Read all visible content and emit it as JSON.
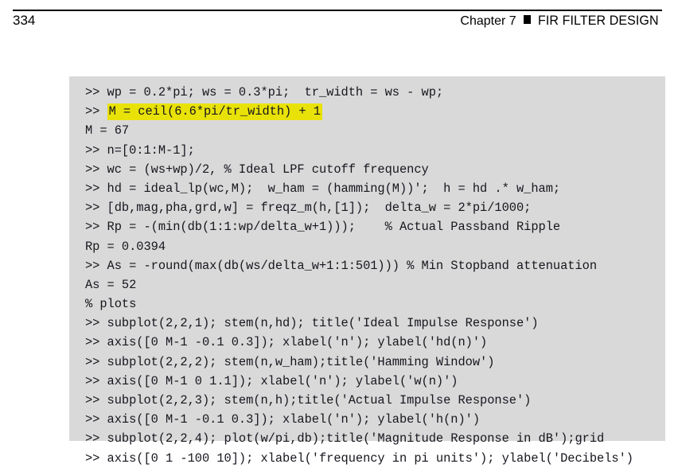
{
  "header": {
    "page_number": "334",
    "chapter_label": "Chapter 7",
    "bullet": "square-bullet",
    "chapter_title": "FIR FILTER DESIGN"
  },
  "code_block": {
    "background_color": "#d9d9d9",
    "text_color": "#16161e",
    "highlight_color": "#e9e209",
    "lines": [
      {
        "text": ">> wp = 0.2*pi; ws = 0.3*pi;  tr_width = ws - wp;",
        "highlight": null
      },
      {
        "text": ">> M = ceil(6.6*pi/tr_width) + 1",
        "highlight": "M = ceil(6.6*pi/tr_width) + 1"
      },
      {
        "text": "M = 67",
        "highlight": null
      },
      {
        "text": ">> n=[0:1:M-1];",
        "highlight": null
      },
      {
        "text": ">> wc = (ws+wp)/2, % Ideal LPF cutoff frequency",
        "highlight": null
      },
      {
        "text": ">> hd = ideal_lp(wc,M);  w_ham = (hamming(M))';  h = hd .* w_ham;",
        "highlight": null
      },
      {
        "text": ">> [db,mag,pha,grd,w] = freqz_m(h,[1]);  delta_w = 2*pi/1000;",
        "highlight": null
      },
      {
        "text": ">> Rp = -(min(db(1:1:wp/delta_w+1)));    % Actual Passband Ripple",
        "highlight": null
      },
      {
        "text": "Rp = 0.0394",
        "highlight": null
      },
      {
        "text": ">> As = -round(max(db(ws/delta_w+1:1:501))) % Min Stopband attenuation",
        "highlight": null
      },
      {
        "text": "As = 52",
        "highlight": null
      },
      {
        "text": "% plots",
        "highlight": null
      },
      {
        "text": ">> subplot(2,2,1); stem(n,hd); title('Ideal Impulse Response')",
        "highlight": null
      },
      {
        "text": ">> axis([0 M-1 -0.1 0.3]); xlabel('n'); ylabel('hd(n)')",
        "highlight": null
      },
      {
        "text": ">> subplot(2,2,2); stem(n,w_ham);title('Hamming Window')",
        "highlight": null
      },
      {
        "text": ">> axis([0 M-1 0 1.1]); xlabel('n'); ylabel('w(n)')",
        "highlight": null
      },
      {
        "text": ">> subplot(2,2,3); stem(n,h);title('Actual Impulse Response')",
        "highlight": null
      },
      {
        "text": ">> axis([0 M-1 -0.1 0.3]); xlabel('n'); ylabel('h(n)')",
        "highlight": null
      },
      {
        "text": ">> subplot(2,2,4); plot(w/pi,db);title('Magnitude Response in dB');grid",
        "highlight": null
      },
      {
        "text": ">> axis([0 1 -100 10]); xlabel('frequency in pi units'); ylabel('Decibels')",
        "highlight": null
      }
    ]
  }
}
